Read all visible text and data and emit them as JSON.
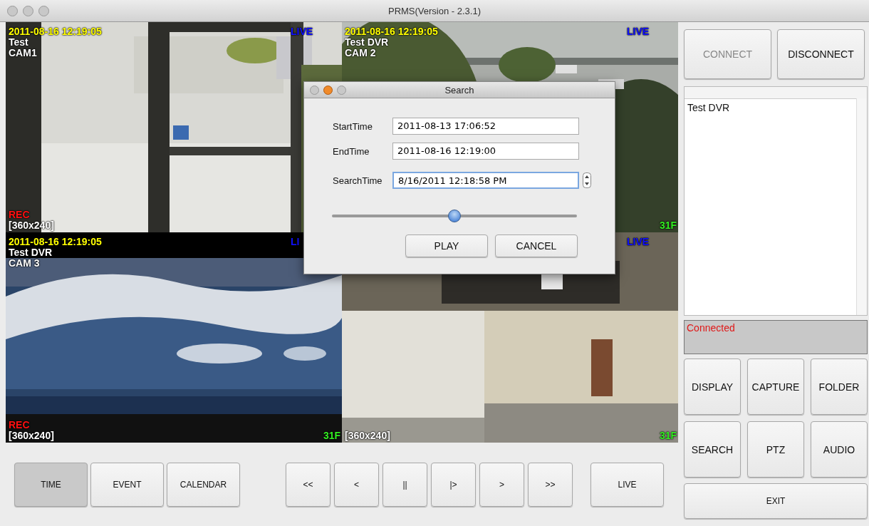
{
  "window": {
    "title": "PRMS(Version - 2.3.1)"
  },
  "cameras": [
    {
      "date": "2011-08-16 12:19:05",
      "name": "Test",
      "cam": "CAM1",
      "live": "LIVE",
      "rec": "REC",
      "resolution": "[360x240]"
    },
    {
      "date": "2011-08-16 12:19:05",
      "name": "Test DVR",
      "cam": "CAM 2",
      "live": "LIVE",
      "fps": "31F"
    },
    {
      "date": "2011-08-16 12:19:05",
      "name": "Test DVR",
      "cam": "CAM 3",
      "live": "LI",
      "rec": "REC",
      "resolution": "[360x240]",
      "fps": "31F"
    },
    {
      "live": "LIVE",
      "resolution": "[360x240]",
      "fps": "31F"
    }
  ],
  "controls": {
    "modes": [
      {
        "label": "TIME",
        "selected": true
      },
      {
        "label": "EVENT",
        "selected": false
      },
      {
        "label": "CALENDAR",
        "selected": false
      }
    ],
    "playback": [
      "<<",
      "<",
      "||",
      "|>",
      ">",
      ">>"
    ],
    "live": "LIVE"
  },
  "search_dialog": {
    "title": "Search",
    "fields": [
      {
        "label": "StartTime",
        "value": "2011-08-13 17:06:52",
        "kind": "text"
      },
      {
        "label": "EndTime",
        "value": "2011-08-16 12:19:00",
        "kind": "text"
      },
      {
        "label": "SearchTime",
        "value": "8/16/2011 12:18:58 PM",
        "kind": "spinner"
      }
    ],
    "slider": {
      "level": 0.5
    },
    "buttons": [
      "PLAY",
      "CANCEL"
    ]
  },
  "sidebar": {
    "connect": {
      "label": "CONNECT",
      "disabled": true
    },
    "disconnect": {
      "label": "DISCONNECT",
      "disabled": false
    },
    "devices": [
      {
        "name": "Test DVR"
      }
    ],
    "status": "Connected",
    "actions": [
      "DISPLAY",
      "CAPTURE",
      "FOLDER",
      "SEARCH",
      "PTZ",
      "AUDIO"
    ],
    "exit": "EXIT"
  }
}
